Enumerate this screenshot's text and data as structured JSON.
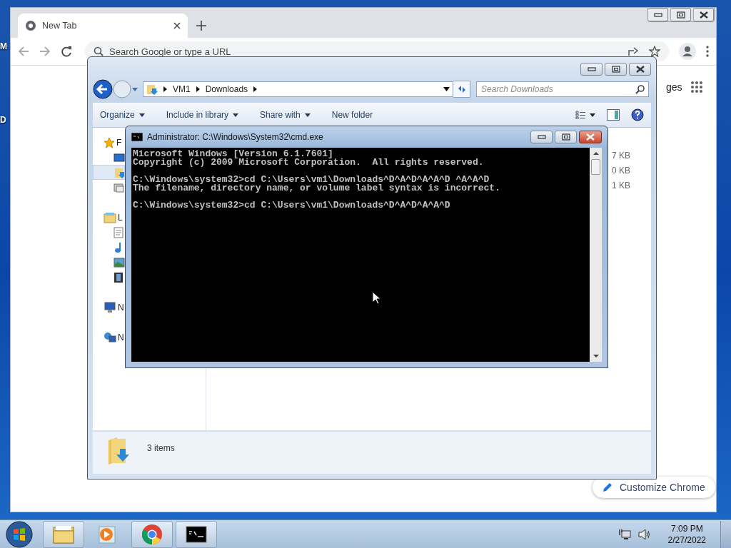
{
  "desktop": {
    "icon_labels": [
      "M",
      "D"
    ]
  },
  "chrome": {
    "tabs": [
      {
        "label": "New Tab",
        "selected": true
      }
    ],
    "omnibox": {
      "placeholder": "Search Google or type a URL"
    },
    "images_link": "ges",
    "customize_button": "Customize Chrome"
  },
  "explorer": {
    "breadcrumb": [
      "VM1",
      "Downloads"
    ],
    "search": {
      "placeholder": "Search Downloads"
    },
    "commands": [
      {
        "label": "Organize",
        "dropdown": true
      },
      {
        "label": "Include in library",
        "dropdown": true
      },
      {
        "label": "Share with",
        "dropdown": true
      },
      {
        "label": "New folder",
        "dropdown": false
      }
    ],
    "nav_groups": [
      {
        "label": "F",
        "kind": "favorites",
        "children": [
          {
            "kind": "desktop",
            "selected": false
          },
          {
            "kind": "downloads",
            "selected": true
          },
          {
            "kind": "recent",
            "selected": false
          }
        ]
      },
      {
        "label": "L",
        "kind": "libraries",
        "children": [
          {
            "kind": "documents",
            "selected": false
          },
          {
            "kind": "music",
            "selected": false
          },
          {
            "kind": "pictures",
            "selected": false
          },
          {
            "kind": "videos",
            "selected": false
          }
        ]
      },
      {
        "label": "N",
        "kind": "computer"
      },
      {
        "label": "N",
        "kind": "network"
      }
    ],
    "file_sizes": [
      "7 KB",
      "0 KB",
      "1 KB"
    ],
    "status": "3 items"
  },
  "cmd": {
    "title": "Administrator: C:\\Windows\\System32\\cmd.exe",
    "blocks": [
      [
        "Microsoft Windows [Version 6.1.7601]",
        "Copyright (c) 2009 Microsoft Corporation.  All rights reserved."
      ],
      [
        "C:\\Windows\\system32>cd C:\\Users\\vm1\\Downloads^D^A^D^A^A^D ^A^A^D",
        "The filename, directory name, or volume label syntax is incorrect."
      ],
      [
        "C:\\Windows\\system32>cd C:\\Users\\vm1\\Downloads^D^A^D^A^A^D"
      ]
    ]
  },
  "taskbar": {
    "apps": [
      {
        "kind": "explorer",
        "running": true
      },
      {
        "kind": "media",
        "running": false
      },
      {
        "kind": "chrome",
        "running": true
      },
      {
        "kind": "cmd",
        "running": true
      }
    ],
    "time": "7:09 PM",
    "date": "2/27/2022"
  }
}
